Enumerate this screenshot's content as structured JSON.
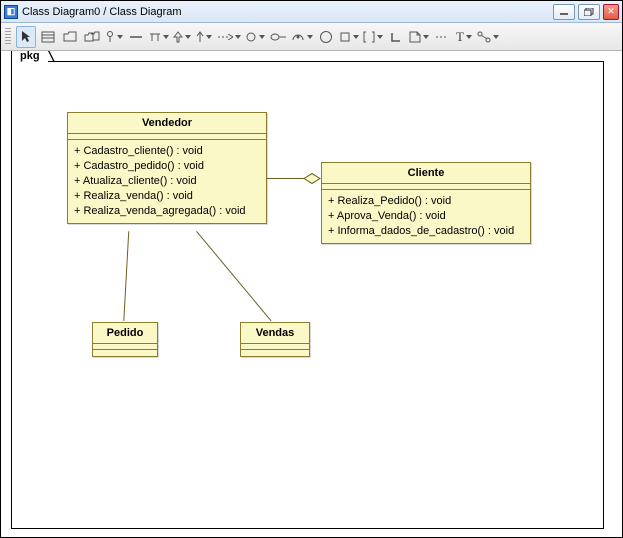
{
  "window": {
    "title": "Class Diagram0 / Class Diagram"
  },
  "package": {
    "label": "pkg"
  },
  "classes": {
    "vendedor": {
      "name": "Vendedor",
      "ops": [
        "+ Cadastro_cliente() : void",
        "+ Cadastro_pedido() : void",
        "+ Atualiza_cliente() : void",
        "+ Realiza_venda() : void",
        "+ Realiza_venda_agregada() : void"
      ]
    },
    "cliente": {
      "name": "Cliente",
      "ops": [
        "+ Realiza_Pedido() : void",
        "+ Aprova_Venda() : void",
        "+ Informa_dados_de_cadastro() : void"
      ]
    },
    "pedido": {
      "name": "Pedido"
    },
    "vendas": {
      "name": "Vendas"
    }
  },
  "chart_data": {
    "type": "uml_class_diagram",
    "package": "pkg",
    "classes": [
      {
        "id": "Vendedor",
        "attributes": [],
        "operations": [
          {
            "vis": "+",
            "name": "Cadastro_cliente",
            "ret": "void"
          },
          {
            "vis": "+",
            "name": "Cadastro_pedido",
            "ret": "void"
          },
          {
            "vis": "+",
            "name": "Atualiza_cliente",
            "ret": "void"
          },
          {
            "vis": "+",
            "name": "Realiza_venda",
            "ret": "void"
          },
          {
            "vis": "+",
            "name": "Realiza_venda_agregada",
            "ret": "void"
          }
        ]
      },
      {
        "id": "Cliente",
        "attributes": [],
        "operations": [
          {
            "vis": "+",
            "name": "Realiza_Pedido",
            "ret": "void"
          },
          {
            "vis": "+",
            "name": "Aprova_Venda",
            "ret": "void"
          },
          {
            "vis": "+",
            "name": "Informa_dados_de_cadastro",
            "ret": "void"
          }
        ]
      },
      {
        "id": "Pedido",
        "attributes": [],
        "operations": []
      },
      {
        "id": "Vendas",
        "attributes": [],
        "operations": []
      }
    ],
    "relationships": [
      {
        "from": "Vendedor",
        "to": "Cliente",
        "type": "aggregation",
        "diamond_at": "Cliente"
      },
      {
        "from": "Vendedor",
        "to": "Pedido",
        "type": "association"
      },
      {
        "from": "Vendedor",
        "to": "Vendas",
        "type": "association"
      }
    ]
  }
}
